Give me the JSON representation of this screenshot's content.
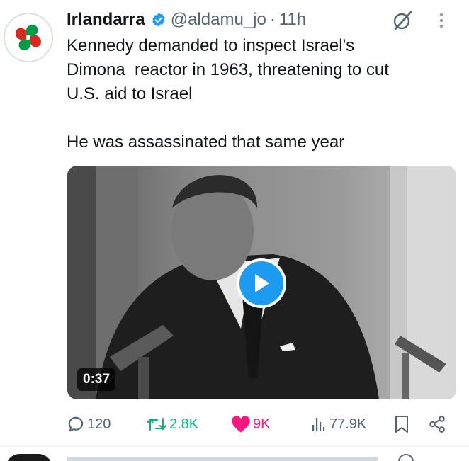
{
  "tweet": {
    "display_name": "Irlandarra",
    "handle": "@aldamu_jo",
    "separator": "·",
    "time": "11h",
    "text_lines": [
      "Kennedy demanded to inspect Israel's",
      "Dimona  reactor in 1963, threatening to cut",
      "U.S. aid to Israel",
      "He was assassinated that same year"
    ],
    "media": {
      "duration": "0:37"
    }
  },
  "actions": {
    "replies": "120",
    "reposts": "2.8K",
    "likes": "9K",
    "views": "77.9K"
  },
  "colors": {
    "accent": "#1d9bf0",
    "repost": "#00ba7c",
    "like": "#f91880",
    "muted": "#536471"
  },
  "icons": {
    "verified": "verified-badge-icon",
    "grok": "grok-icon",
    "more": "more-vertical-icon",
    "reply": "reply-icon",
    "repost": "repost-icon",
    "like": "heart-icon",
    "views": "views-icon",
    "bookmark": "bookmark-icon",
    "share": "share-icon",
    "play": "play-icon"
  }
}
